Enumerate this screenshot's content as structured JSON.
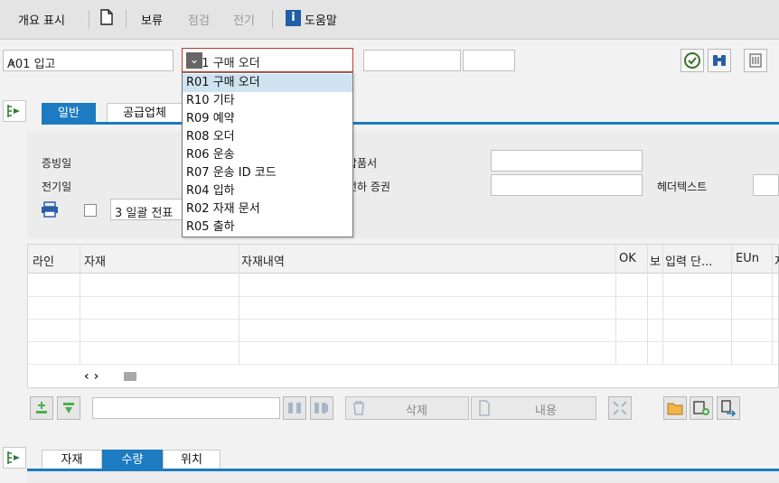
{
  "toolbar": {
    "overview": "개요 표시",
    "hold": "보류",
    "check": "점검",
    "post": "전기",
    "help": "도움말"
  },
  "header": {
    "transaction": "A01 입고",
    "reference": "R01 구매 오더"
  },
  "reference_options": [
    "R01 구매 오더",
    "R10 기타",
    "R09 예약",
    "R08 오더",
    "R06 운송",
    "R07 운송 ID 코드",
    "R04 입하",
    "R02 자재 문서",
    "R05 출하"
  ],
  "tabs_top": [
    "일반",
    "공급업체"
  ],
  "general": {
    "doc_date_label": "증빙일",
    "post_date_label": "전기일",
    "delivery_note_label": "납품서",
    "bill_of_lading_label": "선하 증권",
    "header_text_label": "헤더텍스트",
    "print_option": "3 일괄 전표"
  },
  "grid": {
    "columns": [
      "라인",
      "자재",
      "자재내역",
      "OK",
      "보",
      "입력 단...",
      "EUn",
      "저"
    ],
    "nav": "‹ ›"
  },
  "actions": {
    "delete": "삭제",
    "content": "내용"
  },
  "tabs_bottom": [
    "자재",
    "수량",
    "위치"
  ],
  "colors": {
    "accent": "#1c7bc1",
    "selection": "#cfe3f1"
  }
}
